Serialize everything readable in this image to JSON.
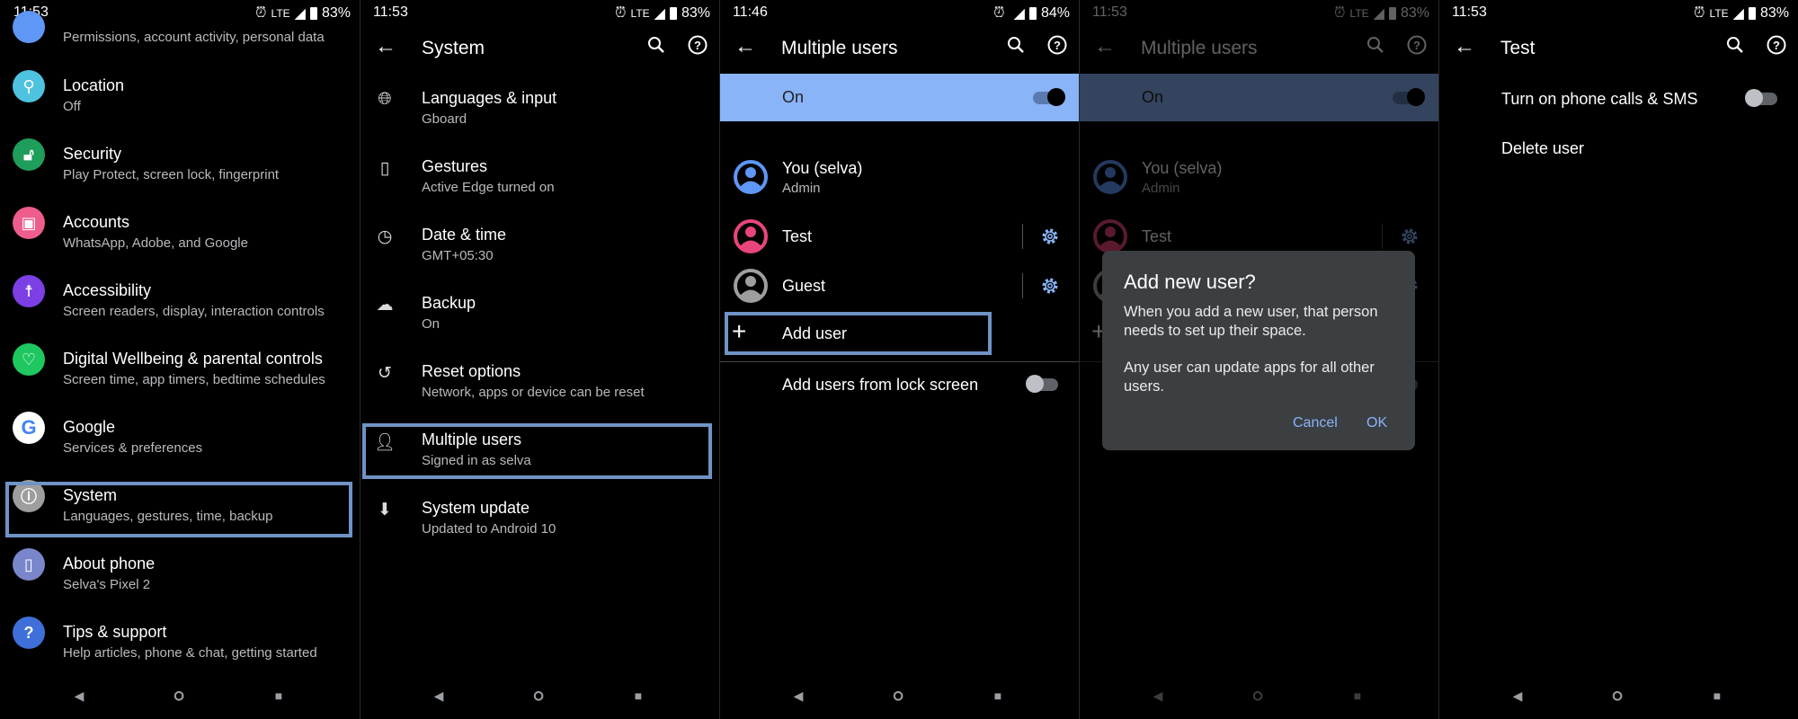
{
  "status_bars": [
    {
      "time": "11:53",
      "network": "LTE",
      "battery": "83%"
    },
    {
      "time": "11:53",
      "network": "LTE",
      "battery": "83%"
    },
    {
      "time": "11:46",
      "network": "",
      "battery": "84%"
    },
    {
      "time": "11:53",
      "network": "LTE",
      "battery": "83%"
    },
    {
      "time": "11:53",
      "network": "LTE",
      "battery": "83%"
    }
  ],
  "settings": {
    "partial_subtitle": "Permissions, account activity, personal data",
    "items": [
      {
        "title": "Location",
        "subtitle": "Off",
        "icon": "location-icon",
        "color": "#4ec3e0",
        "glyph": "⚲"
      },
      {
        "title": "Security",
        "subtitle": "Play Protect, screen lock, fingerprint",
        "icon": "lock-open-icon",
        "color": "#1e9e5a",
        "glyph": "🔓︎"
      },
      {
        "title": "Accounts",
        "subtitle": "WhatsApp, Adobe, and Google",
        "icon": "accounts-icon",
        "color": "#ee5d8c",
        "glyph": "▣"
      },
      {
        "title": "Accessibility",
        "subtitle": "Screen readers, display, interaction controls",
        "icon": "accessibility-icon",
        "color": "#7b3fe4",
        "glyph": "☨"
      },
      {
        "title": "Digital Wellbeing & parental controls",
        "subtitle": "Screen time, app timers, bedtime schedules",
        "icon": "wellbeing-icon",
        "color": "#1ec760",
        "glyph": "♡"
      },
      {
        "title": "Google",
        "subtitle": "Services & preferences",
        "icon": "google-icon",
        "color": "#ffffff",
        "glyph": "G"
      },
      {
        "title": "System",
        "subtitle": "Languages, gestures, time, backup",
        "icon": "info-icon",
        "color": "#9e9e9e",
        "glyph": "ⓘ"
      },
      {
        "title": "About phone",
        "subtitle": "Selva's Pixel 2",
        "icon": "phone-icon",
        "color": "#7986cb",
        "glyph": "▯"
      },
      {
        "title": "Tips & support",
        "subtitle": "Help articles, phone & chat, getting started",
        "icon": "help-icon",
        "color": "#3f6fd8",
        "glyph": "?"
      }
    ]
  },
  "system": {
    "title": "System",
    "items": [
      {
        "title": "Languages & input",
        "subtitle": "Gboard",
        "icon": "globe-icon",
        "glyph": "🌐︎"
      },
      {
        "title": "Gestures",
        "subtitle": "Active Edge turned on",
        "icon": "gestures-icon",
        "glyph": "▯"
      },
      {
        "title": "Date & time",
        "subtitle": "GMT+05:30",
        "icon": "clock-icon",
        "glyph": "◷"
      },
      {
        "title": "Backup",
        "subtitle": "On",
        "icon": "cloud-upload-icon",
        "glyph": "☁"
      },
      {
        "title": "Reset options",
        "subtitle": "Network, apps or device can be reset",
        "icon": "history-icon",
        "glyph": "↺"
      },
      {
        "title": "Multiple users",
        "subtitle": "Signed in as selva",
        "icon": "person-icon",
        "glyph": "👤︎"
      },
      {
        "title": "System update",
        "subtitle": "Updated to Android 10",
        "icon": "system-update-icon",
        "glyph": "⬇"
      }
    ]
  },
  "multiple_users": {
    "title": "Multiple users",
    "master_toggle": {
      "label": "On",
      "on": true
    },
    "users": [
      {
        "name": "You (selva)",
        "role": "Admin",
        "color": "#5e97f6",
        "settings": false
      },
      {
        "name": "Test",
        "role": "",
        "color": "#e9457a",
        "settings": true
      },
      {
        "name": "Guest",
        "role": "",
        "color": "#9e9e9e",
        "settings": true
      }
    ],
    "add_user": "Add user",
    "lock_screen": {
      "label": "Add users from lock screen",
      "on": false
    }
  },
  "dialog": {
    "title": "Add new user?",
    "body1": "When you add a new user, that person needs to set up their space.",
    "body2": "Any user can update apps for all other users.",
    "cancel": "Cancel",
    "ok": "OK"
  },
  "test_user": {
    "title": "Test",
    "calls_toggle": {
      "label": "Turn on phone calls & SMS",
      "on": false
    },
    "delete": "Delete user"
  },
  "colors": {
    "accent": "#8ab4f8",
    "highlight_box": "#6f93c6",
    "dialog_bg": "#3c3f42"
  }
}
